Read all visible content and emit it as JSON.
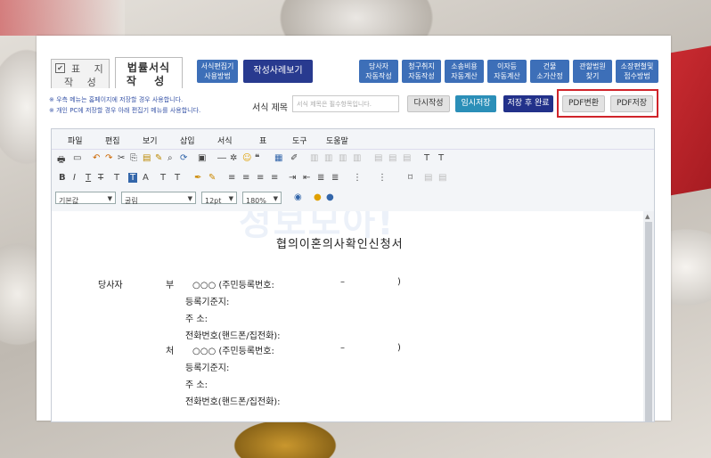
{
  "tabs": {
    "pyoji_l1": "표 지",
    "pyoji_l2": "작 성",
    "legal_l1": "법률서식",
    "legal_l2": "작 성"
  },
  "top_buttons": {
    "editor_usage": [
      "서식편집기",
      "사용방법"
    ],
    "examples": "작성사례보기",
    "auto": [
      [
        "당사자",
        "자동작성"
      ],
      [
        "청구취지",
        "자동작성"
      ],
      [
        "소송비용",
        "자동계산"
      ],
      [
        "이자등",
        "자동계산"
      ],
      [
        "건물",
        "소가산정"
      ],
      [
        "관할법원",
        "찾기"
      ],
      [
        "소장편철및",
        "접수방법"
      ]
    ]
  },
  "notes": [
    "※ 우측 메뉴는 홈페이지에 저장할 경우 사용합니다.",
    "※ 개인 PC에 저장할 경우 아래 편집기 메뉴를 사용합니다."
  ],
  "title": {
    "label": "서식 제목",
    "placeholder": "서식 제목은 필수항목입니다."
  },
  "actions": {
    "rewrite": "다시작성",
    "temp_save": "임시저장",
    "save_done": "저장 후 완료",
    "pdf_convert": "PDF변환",
    "pdf_save": "PDF저장"
  },
  "menu": [
    "파일",
    "편집",
    "보기",
    "삽입",
    "서식",
    "표",
    "도구",
    "도움말"
  ],
  "format": {
    "style": "기본값",
    "font": "굴림",
    "size": "12pt",
    "zoom": "180%"
  },
  "watermark": "정보모아!",
  "doc": {
    "heading": "협의이혼의사확인신청서",
    "party": "당사자",
    "husband": "부",
    "wife": "처",
    "name_line": "○○○  (주민등록번호:",
    "dash": "–",
    "paren": ")",
    "reg": "등록기준지:",
    "addr": "주         소:",
    "phone": "전화번호(핸드폰/집전화):"
  }
}
